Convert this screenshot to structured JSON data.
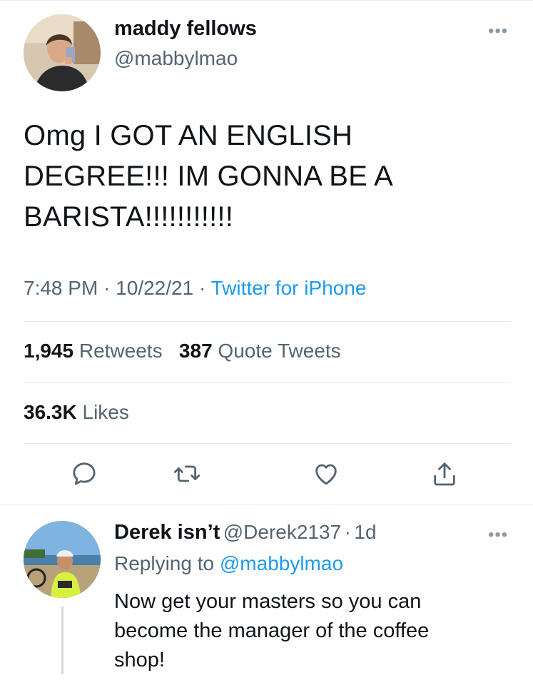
{
  "tweet": {
    "author_name": "maddy fellows",
    "author_handle": "@mabbylmao",
    "text_lines": [
      "Omg I GOT AN ENGLISH",
      "DEGREE!!! IM GONNA BE A",
      "BARISTA!!!!!!!!!!!"
    ],
    "time": "7:48 PM",
    "date": "10/22/21",
    "source": "Twitter for iPhone",
    "separator": "·",
    "retweets_count": "1,945",
    "retweets_label": "Retweets",
    "quotes_count": "387",
    "quotes_label": "Quote Tweets",
    "likes_count": "36.3K",
    "likes_label": "Likes",
    "more_glyph": "•••"
  },
  "actions": [
    {
      "name": "reply",
      "icon": "reply-icon"
    },
    {
      "name": "retweet",
      "icon": "retweet-icon"
    },
    {
      "name": "like",
      "icon": "heart-icon"
    },
    {
      "name": "share",
      "icon": "share-icon"
    }
  ],
  "reply": {
    "author_name": "Derek isn’t",
    "author_handle": "@Derek2137",
    "separator": "·",
    "age": "1d",
    "replying_to_label": "Replying to",
    "replying_to_handle": "@mabbylmao",
    "text_lines": [
      "Now get your masters so you can",
      "become the manager of the coffee",
      "shop!"
    ],
    "more_glyph": "•••"
  },
  "colors": {
    "text": "#0f1419",
    "secondary": "#536471",
    "link": "#1d9bf0",
    "divider": "#e6e9ec"
  }
}
